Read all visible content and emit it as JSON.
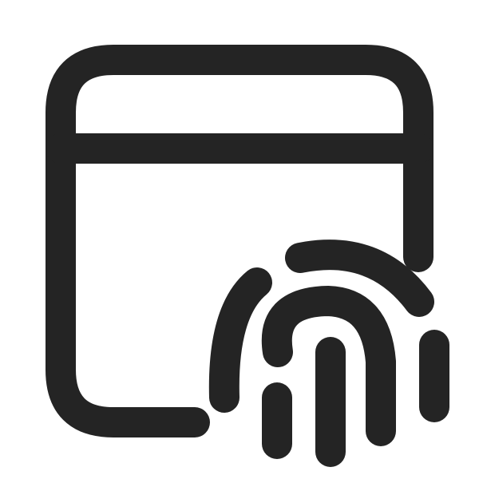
{
  "icon": {
    "name": "window-fingerprint-icon",
    "color": "#242424",
    "background": "#ffffff"
  }
}
